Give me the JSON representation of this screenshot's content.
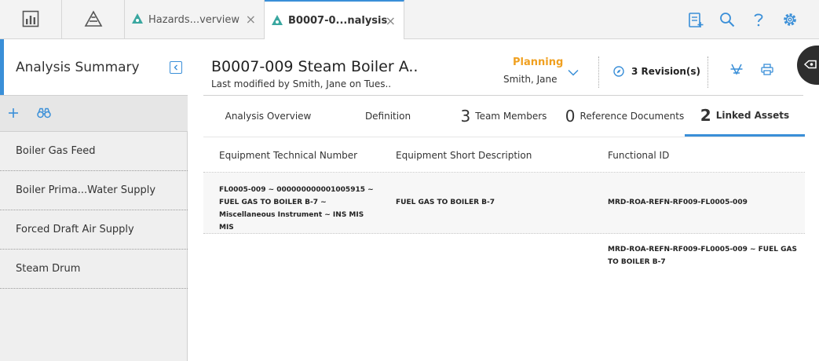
{
  "topbar": {
    "tabs": [
      {
        "label": "Hazards...verview",
        "close": "×"
      },
      {
        "label": "B0007-0...nalysis",
        "close": "×"
      }
    ]
  },
  "left_panel": {
    "title": "Analysis Summary",
    "items": [
      {
        "label": "Boiler Gas Feed"
      },
      {
        "label": "Boiler Prima...Water Supply"
      },
      {
        "label": "Forced Draft Air Supply"
      },
      {
        "label": "Steam Drum"
      }
    ]
  },
  "header": {
    "title": "B0007-009 Steam Boiler A..",
    "subtitle": "Last modified by Smith, Jane on Tues..",
    "state": "Planning",
    "state_owner": "Smith, Jane",
    "revisions": "3 Revision(s)"
  },
  "subtabs": [
    {
      "count": "",
      "label": "Analysis Overview"
    },
    {
      "count": "",
      "label": "Definition"
    },
    {
      "count": "3",
      "label": "Team Members"
    },
    {
      "count": "0",
      "label": "Reference Documents"
    },
    {
      "count": "2",
      "label": "Linked Assets"
    }
  ],
  "table": {
    "columns": [
      "Equipment Technical Number",
      "Equipment Short Description",
      "Functional ID"
    ],
    "rows": [
      {
        "technical_number": "FL0005-009 ~ 000000000001005915 ~ FUEL GAS TO BOILER B-7 ~ Miscellaneous Instrument ~ INS MIS MIS",
        "short_description": "FUEL GAS TO BOILER B-7",
        "functional_id": "MRD-ROA-REFN-RF009-FL0005-009"
      },
      {
        "technical_number": "",
        "short_description": "",
        "functional_id": "MRD-ROA-REFN-RF009-FL0005-009 ~ FUEL GAS TO BOILER B-7"
      }
    ]
  },
  "colors": {
    "accent": "#3a8fd8",
    "state": "#f0a020",
    "topbar_bg": "#f3f3f3",
    "panel_bg": "#efefef"
  },
  "icons": {
    "topbar": [
      "dashboard-icon",
      "hazards-home-icon",
      "hazards-tab-icon",
      "checklist-icon",
      "search-icon",
      "help-icon",
      "settings-icon"
    ],
    "header": [
      "chevron-down-icon",
      "compass-icon",
      "asset-hierarchy-icon",
      "print-icon",
      "side-panel-icon"
    ],
    "left_panel": [
      "collapse-left-icon",
      "add-icon",
      "binoculars-icon"
    ]
  }
}
